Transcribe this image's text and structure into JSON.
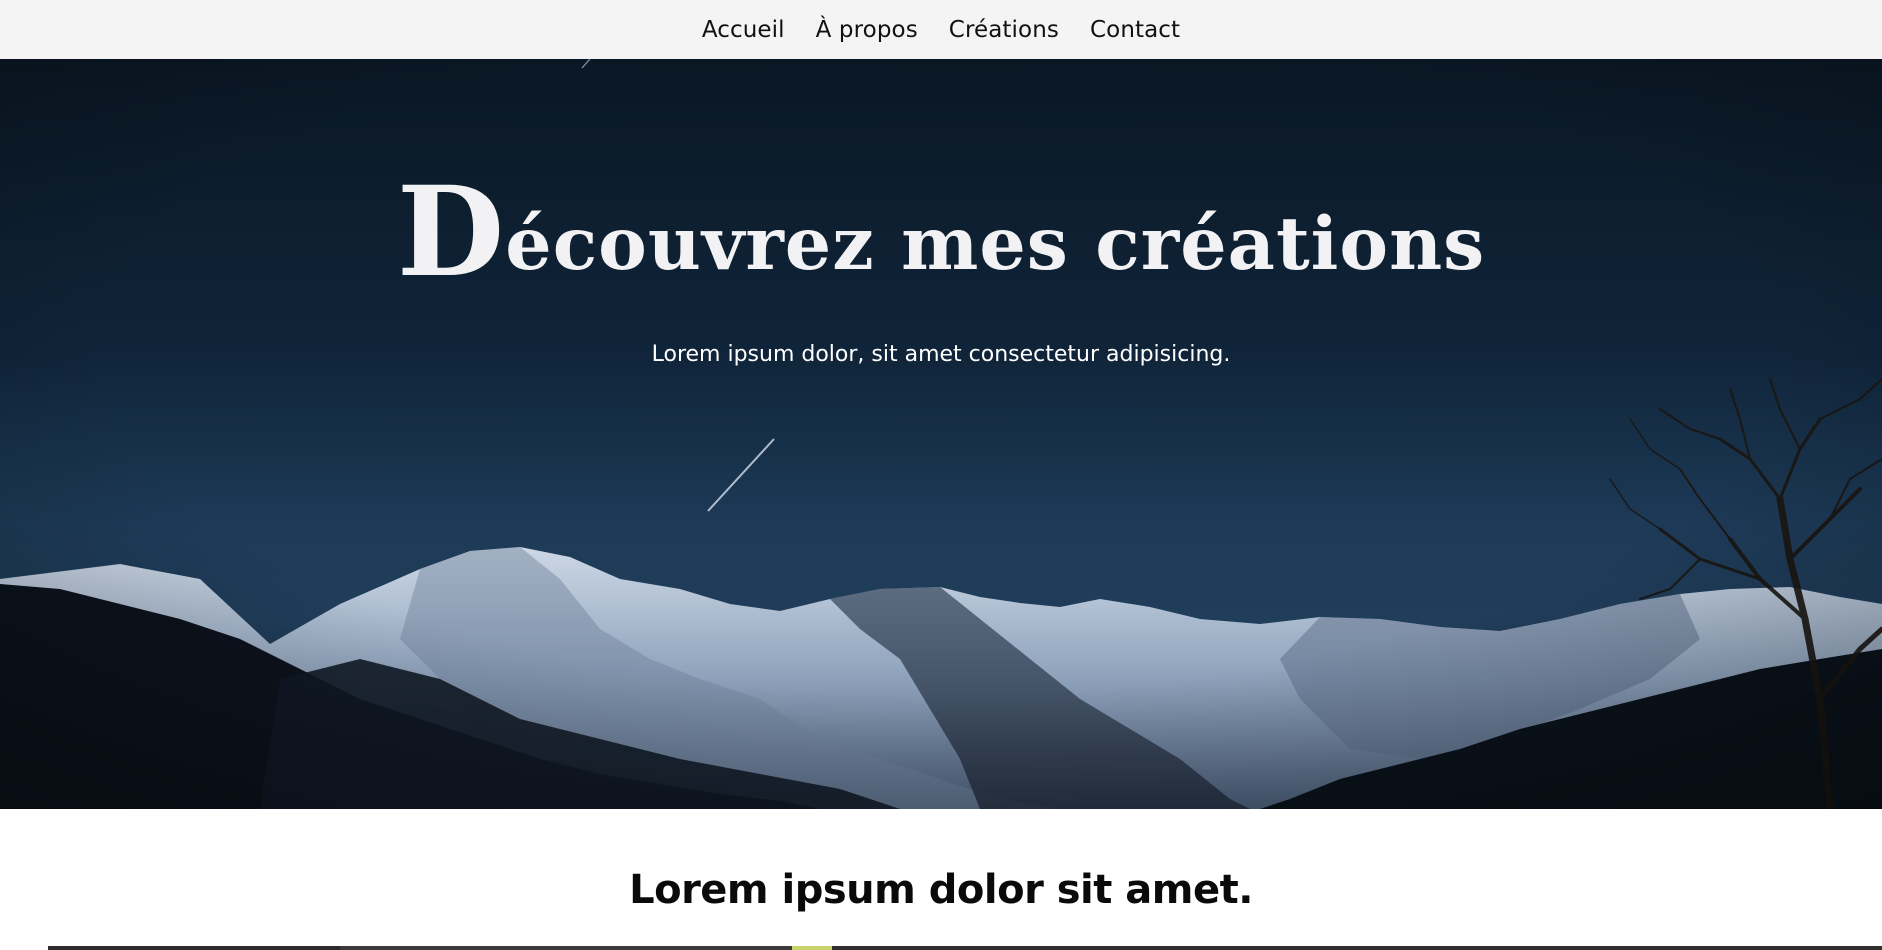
{
  "nav": {
    "items": [
      {
        "label": "Accueil"
      },
      {
        "label": "À propos"
      },
      {
        "label": "Créations"
      },
      {
        "label": "Contact"
      }
    ]
  },
  "hero": {
    "title_first_letter": "D",
    "title_rest": "écouvrez mes créations",
    "subtitle": "Lorem ipsum dolor, sit amet consectetur adipisicing.",
    "background": "night-mountain-photo"
  },
  "section": {
    "heading": "Lorem ipsum dolor sit amet."
  },
  "colors": {
    "nav_bg": "#f4f4f4",
    "sky_dark": "#0b1826",
    "snow": "#c4d0e0",
    "text_light": "#f2f2f4"
  }
}
